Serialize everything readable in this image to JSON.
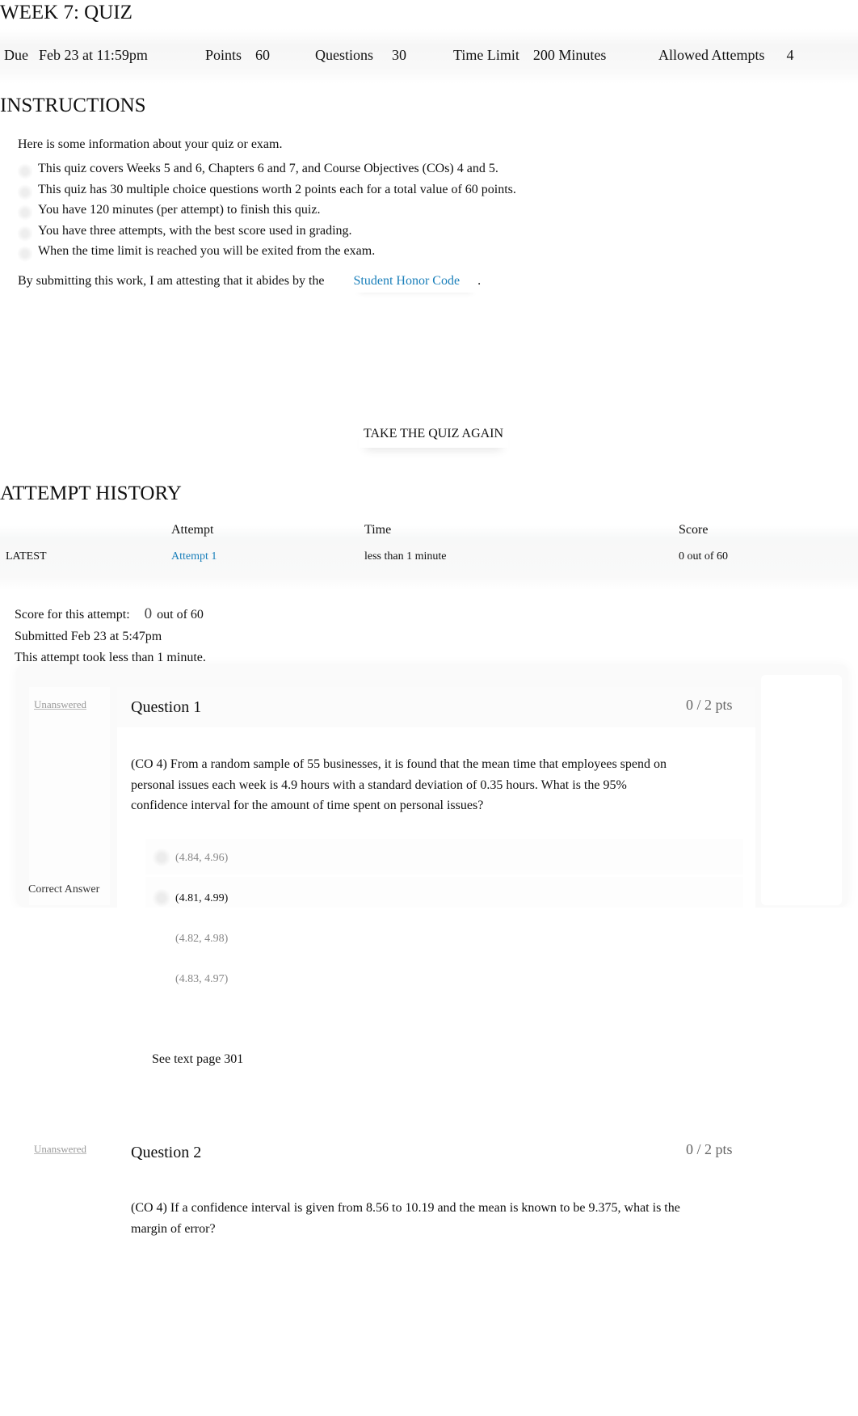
{
  "page": {
    "title": "WEEK 7: QUIZ"
  },
  "meta": {
    "due_label": "Due",
    "due_value": "Feb 23 at 11:59pm",
    "points_label": "Points",
    "points_value": "60",
    "questions_label": "Questions",
    "questions_value": "30",
    "time_limit_label": "Time Limit",
    "time_limit_value": "200 Minutes",
    "attempts_label": "Allowed Attempts",
    "attempts_value": "4"
  },
  "instructions": {
    "heading": "INSTRUCTIONS",
    "intro": "Here is some information about your quiz or exam.",
    "bullets": [
      "This quiz covers Weeks 5 and 6, Chapters 6 and 7, and Course Objectives (COs) 4 and 5.",
      "This quiz has 30 multiple choice questions worth 2 points each for a total value of 60 points.",
      "You have 120 minutes (per attempt) to finish this quiz.",
      "You have three attempts, with the best score used in grading.",
      "When the time limit is reached you will be exited from the exam."
    ],
    "honor_prefix": "By submitting this work, I am attesting that it abides by the",
    "honor_link": "Student Honor Code",
    "honor_suffix": "."
  },
  "actions": {
    "take_quiz_again": "TAKE THE QUIZ AGAIN"
  },
  "history": {
    "heading": "ATTEMPT HISTORY",
    "columns": [
      "",
      "Attempt",
      "Time",
      "Score"
    ],
    "rows": [
      {
        "tag": "LATEST",
        "attempt": "Attempt 1",
        "time": "less than 1 minute",
        "score": "0 out of 60"
      }
    ]
  },
  "attempt_summary": {
    "score_label": "Score for this attempt:",
    "score_value": "0",
    "score_suffix": "out of 60",
    "submitted": "Submitted Feb 23 at 5:47pm",
    "duration": "This attempt took less than 1 minute."
  },
  "questions": [
    {
      "status": "Unanswered",
      "title": "Question 1",
      "points": "0 / 2 pts",
      "text": "(CO 4) From a random sample of 55 businesses, it is found that the mean time that employees spend on personal issues each week is 4.9 hours with a standard deviation of 0.35 hours. What is the 95% confidence interval for the amount of time spent on personal issues?",
      "answers": [
        "(4.84, 4.96)",
        "(4.81, 4.99)",
        "(4.82, 4.98)",
        "(4.83, 4.97)"
      ],
      "correct_index": 1,
      "correct_label": "Correct Answer",
      "comment": "See text page 301"
    },
    {
      "status": "Unanswered",
      "title": "Question 2",
      "points": "0 / 2 pts",
      "text": "(CO 4) If a confidence interval is given from 8.56 to 10.19 and the mean is known to be 9.375, what is the margin of error?"
    }
  ]
}
